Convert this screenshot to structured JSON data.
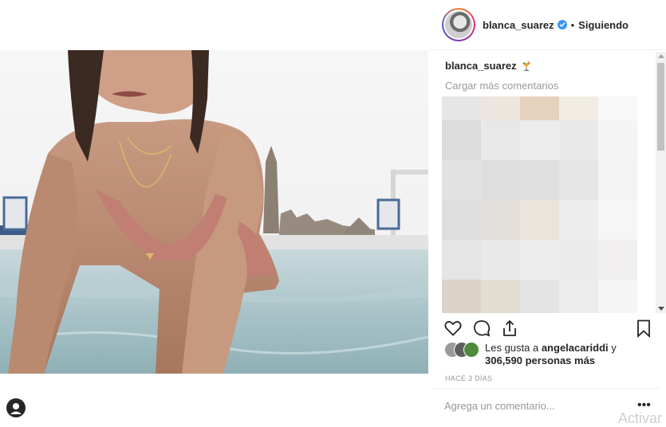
{
  "post": {
    "image_alt": "photo",
    "profile_icon": "user-circle-icon"
  },
  "header": {
    "username": "blanca_suarez",
    "verified_icon": "verified-badge-icon",
    "separator": "•",
    "follow_status": "Siguiendo"
  },
  "comments": {
    "caption_user": "blanca_suarez",
    "caption_emoji": "tropical-drink-icon",
    "load_more": "Cargar más comentarios"
  },
  "actions": {
    "like_icon": "heart-icon",
    "comment_icon": "comment-icon",
    "share_icon": "share-icon",
    "save_icon": "bookmark-icon"
  },
  "likes": {
    "prefix": "Les gusta a ",
    "user": "angelacariddi",
    "conjunction": " y",
    "count": "306,590 personas más"
  },
  "time_ago": "HACE 3 DÍAS",
  "comment_box": {
    "placeholder": "Agrega un comentario...",
    "more_label": "•••"
  },
  "watermark": "Activar",
  "colors": {
    "accent": "#3897f0",
    "muted": "#999999",
    "text": "#262626"
  }
}
